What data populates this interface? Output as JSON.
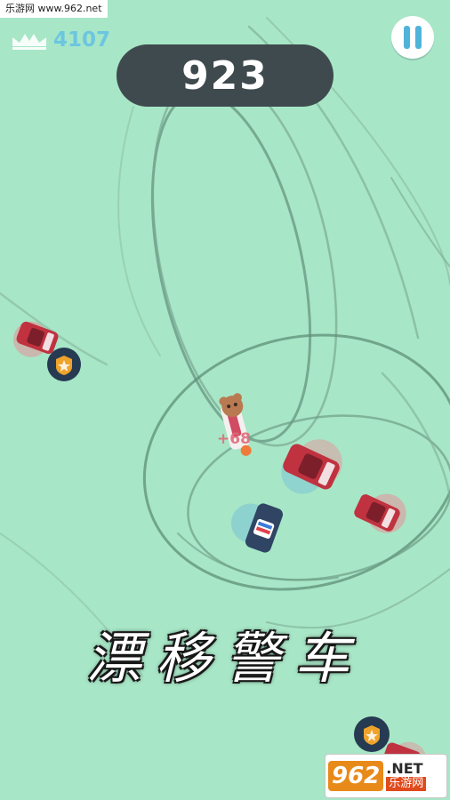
{
  "watermark": {
    "text": "乐游网 www.962.net"
  },
  "hud": {
    "best_icon": "crown-icon",
    "best_score": "4107",
    "current_score": "923",
    "pause_icon": "pause-icon"
  },
  "play": {
    "combo_text": "+68",
    "badge_icon": "police-badge-icon"
  },
  "title": {
    "text": "漂移警车"
  },
  "brand": {
    "number": "962",
    "net": ".NET",
    "name": "乐游网"
  },
  "colors": {
    "background": "#a7e6c6",
    "score_panel": "#3f4a4e",
    "best_score": "#6cc6e0",
    "red_car": "#c0323f",
    "police_car": "#2f4563",
    "badge": "#263a52",
    "star": "#f0a32a"
  }
}
